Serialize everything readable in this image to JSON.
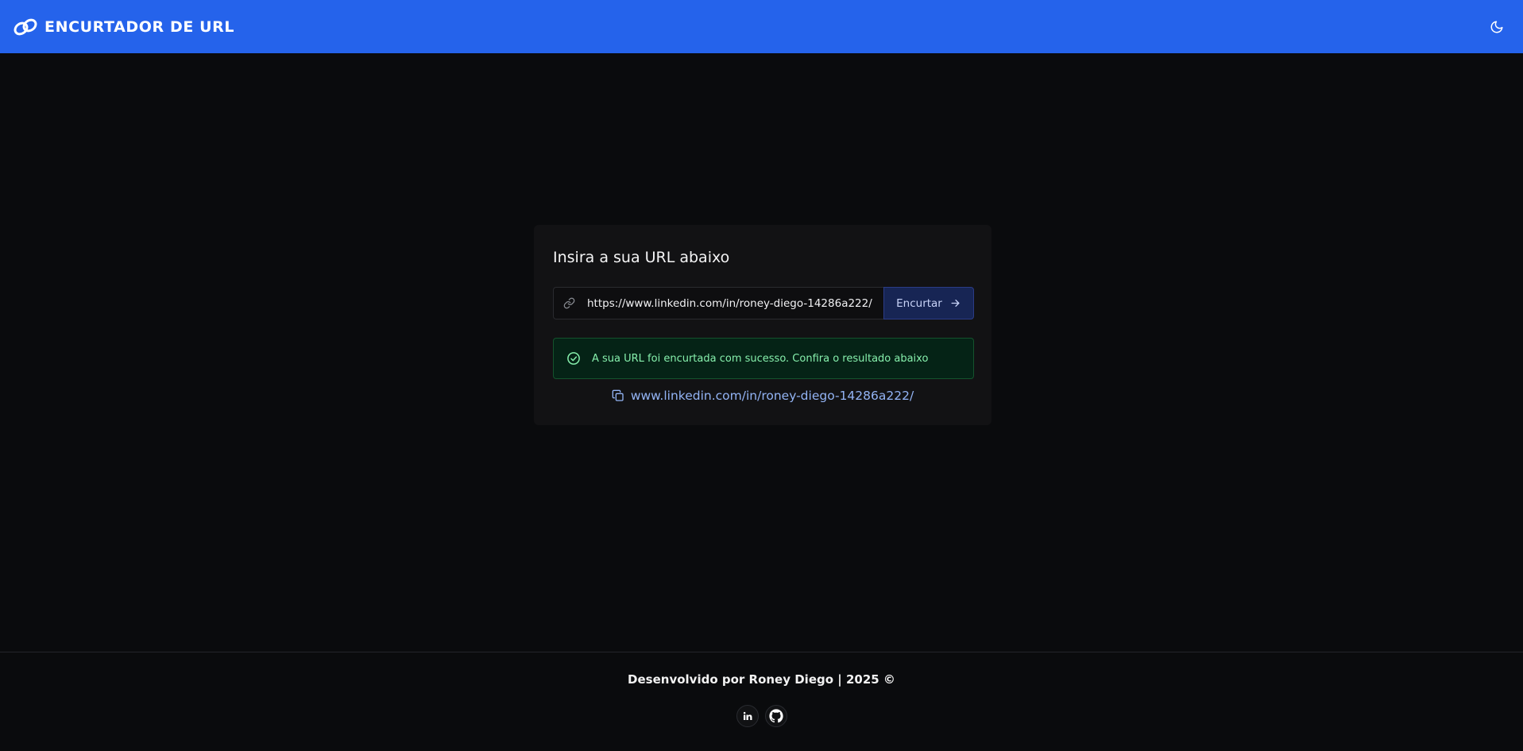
{
  "header": {
    "title": "ENCURTADOR DE URL",
    "logo_icon": "link-chain-icon",
    "theme_toggle_icon": "moon-icon"
  },
  "card": {
    "title": "Insira a sua URL abaixo",
    "input": {
      "value": "https://www.linkedin.com/in/roney-diego-14286a222/",
      "icon": "link-icon"
    },
    "button": {
      "label": "Encurtar",
      "icon": "arrow-right-icon"
    },
    "alert": {
      "icon": "check-circle-icon",
      "text": "A sua URL foi encurtada com sucesso. Confira o resultado abaixo"
    },
    "result": {
      "icon": "copy-icon",
      "text": "www.linkedin.com/in/roney-diego-14286a222/"
    }
  },
  "footer": {
    "text": "Desenvolvido por Roney Diego | 2025 ©",
    "social": [
      {
        "icon": "linkedin-icon",
        "label": "in"
      },
      {
        "icon": "github-icon"
      }
    ]
  },
  "colors": {
    "header_bg": "#2563eb",
    "page_bg": "#0a0b0d",
    "card_bg": "#121214",
    "alert_bg": "#052316",
    "alert_text": "#86efac",
    "button_bg": "#172554",
    "link_text": "#93b4f5"
  }
}
